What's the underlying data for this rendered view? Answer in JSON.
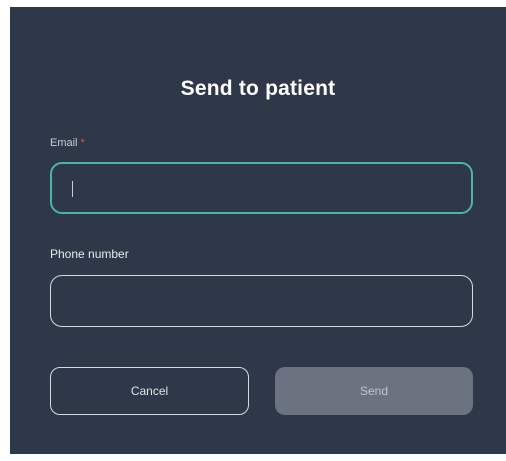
{
  "dialog": {
    "title": "Send to patient",
    "email": {
      "label": "Email",
      "required_mark": "*",
      "value": "",
      "placeholder": ""
    },
    "phone": {
      "label": "Phone number",
      "value": "",
      "placeholder": ""
    },
    "buttons": {
      "cancel": "Cancel",
      "send": "Send"
    }
  },
  "colors": {
    "dialog_background": "#2f3848",
    "focus_border": "#4fb3a6",
    "required_mark": "#d9534f",
    "send_button_disabled": "#6c7380"
  }
}
